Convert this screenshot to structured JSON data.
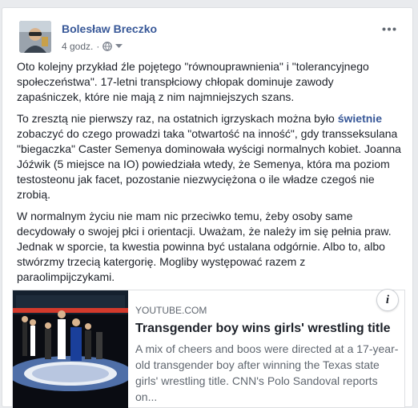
{
  "post": {
    "author": "Bolesław Breczko",
    "time": "4 godz.",
    "privacy_icon": "globe-icon",
    "menu_icon": "more-icon",
    "paragraphs": [
      "Oto kolejny przykład źle pojętego \"równouprawnienia\" i \"tolerancyjnego społeczeństwa\". 17-letni transpłciowy chłopak dominuje zawody zapaśniczek, które nie mają z nim najmniejszych szans.",
      "W normalnym życiu nie mam nic przeciwko temu, żeby osoby same decydowały o swojej płci i orientacji. Uważam, że należy im się pełnia praw. Jednak w sporcie, ta kwestia powinna być ustalana odgórnie. Albo to, albo stwórzmy trzecią katergorię. Mogliby występować razem z paraolimpijczykami."
    ],
    "paragraph2": {
      "before": "To zresztą nie pierwszy raz, na ostatnich igrzyskach można było ",
      "link": "świetnie",
      "after": " zobaczyć do czego prowadzi taka \"otwartość na inność\", gdy transseksulana \"biegaczka\" Caster Semenya dominowała wyścigi normalnych kobiet. Joanna Jóźwik (5 miejsce na IO) powiedziała wtedy, że Semenya, która ma poziom testosteonu jak facet, pozostanie niezwyciężona o ile władze czegoś nie zrobią."
    }
  },
  "preview": {
    "domain": "YOUTUBE.COM",
    "title": "Transgender boy wins girls' wrestling title",
    "description": "A mix of cheers and boos were directed at a 17-year-old transgender boy after winning the Texas state girls' wrestling title. CNN's Polo Sandoval reports on...",
    "info_icon": "info-icon",
    "info_label": "i"
  }
}
